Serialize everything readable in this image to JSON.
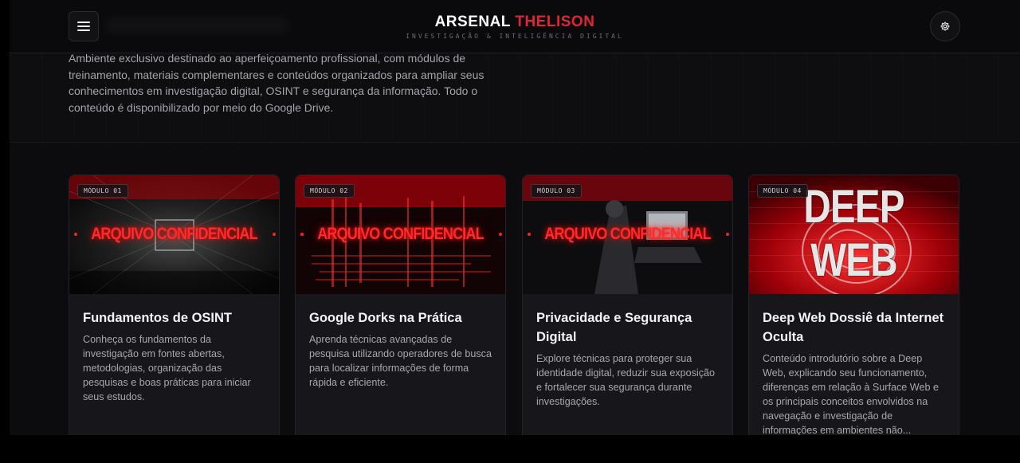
{
  "header": {
    "brand_primary": "ARSENAL",
    "brand_accent": "THELISON",
    "brand_subtitle": "INVESTIGAÇÃO & INTELIGÊNCIA DIGITAL",
    "menu_icon": "hamburger-menu-icon",
    "settings_icon": "gear-icon"
  },
  "intro": {
    "text": "Ambiente exclusivo destinado ao aperfeiçoamento profissional, com módulos de treinamento, materiais complementares e conteúdos organizados para ampliar seus conhecimentos em investigação digital, OSINT e segurança da informação. Todo o conteúdo é disponibilizado por meio do Google Drive."
  },
  "colors": {
    "accent": "#e02633",
    "background": "#0c0c0f",
    "card": "#17171b"
  },
  "modules": [
    {
      "badge": "MÓDULO 01",
      "stamp": "ARQUIVO CONFIDENCIAL",
      "title": "Fundamentos de OSINT",
      "description": "Conheça os fundamentos da investigação em fontes abertas, metodologias, organização das pesquisas e boas práticas para iniciar seus estudos."
    },
    {
      "badge": "MÓDULO 02",
      "stamp": "ARQUIVO CONFIDENCIAL",
      "title": "Google Dorks na Prática",
      "description": "Aprenda técnicas avançadas de pesquisa utilizando operadores de busca para localizar informações de forma rápida e eficiente."
    },
    {
      "badge": "MÓDULO 03",
      "stamp": "ARQUIVO CONFIDENCIAL",
      "title": "Privacidade e Segurança Digital",
      "description": "Explore técnicas para proteger sua identidade digital, reduzir sua exposição e fortalecer sua segurança durante investigações."
    },
    {
      "badge": "MÓDULO 04",
      "image_title": "DEEP WEB",
      "title": "Deep Web Dossiê da Internet Oculta",
      "description": "Conteúdo introdutório sobre a Deep Web, explicando seu funcionamento, diferenças em relação à Surface Web e os principais conceitos envolvidos na navegação e investigação de informações em ambientes não..."
    }
  ]
}
